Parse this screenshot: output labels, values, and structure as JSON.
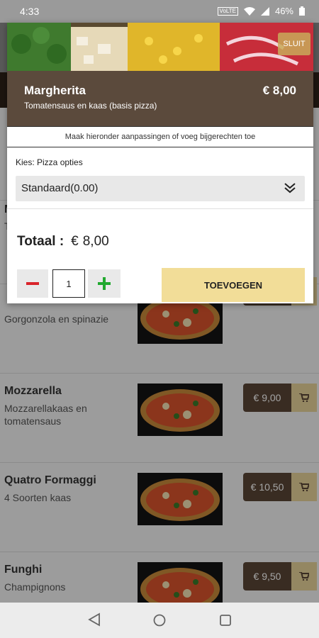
{
  "status": {
    "time": "4:33",
    "network": "VoLTE",
    "battery": "46%"
  },
  "modal": {
    "close_label": "SLUIT",
    "product_name": "Margherita",
    "product_desc": "Tomatensaus en kaas (basis pizza)",
    "product_price": "€ 8,00",
    "instruction": "Maak hieronder aanpassingen of voeg bijgerechten toe",
    "option_label": "Kies: Pizza opties",
    "option_value": "Standaard(0.00)",
    "total_label": "Totaal :",
    "total_currency": "€",
    "total_amount": "8,00",
    "quantity": "1",
    "add_label": "TOEVOEGEN"
  },
  "menu": {
    "partial_first_letter": "M",
    "partial_second_letter": "T",
    "partial_desc": "Gorgonzola en spinazie",
    "items": [
      {
        "name": "Mozzarella",
        "desc": "Mozzarellakaas en tomatensaus",
        "price": "€ 9,00"
      },
      {
        "name": "Quatro Formaggi",
        "desc": "4 Soorten kaas",
        "price": "€ 10,50"
      },
      {
        "name": "Funghi",
        "desc": "Champignons",
        "price": "€ 9,50"
      }
    ]
  },
  "colors": {
    "brown": "#5b4a3c",
    "gold": "#f2dd98",
    "green_plus": "#21a92f",
    "red_minus": "#d9242b"
  }
}
